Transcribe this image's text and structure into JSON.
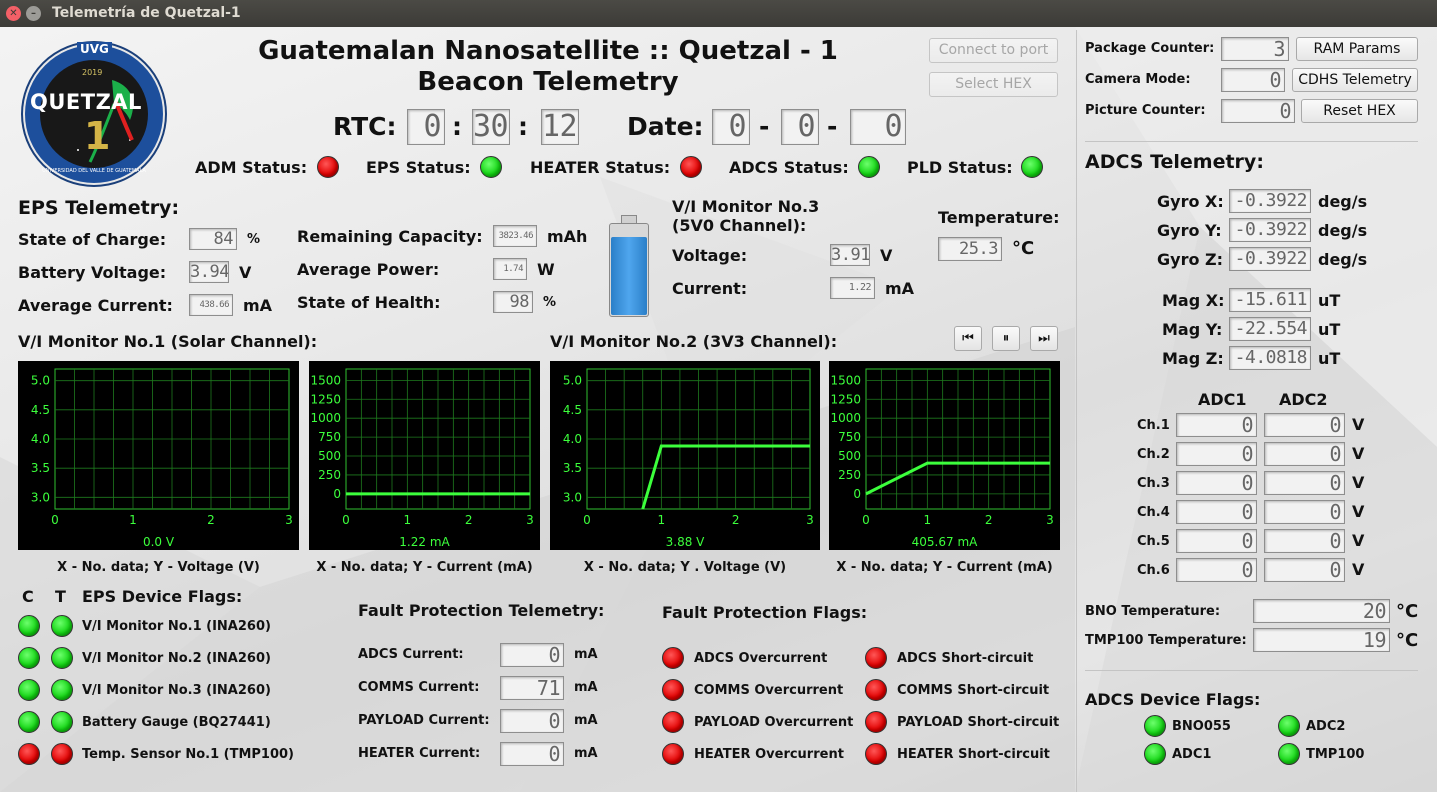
{
  "window": {
    "title": "Telemetría de Quetzal-1"
  },
  "header": {
    "title": "Guatemalan Nanosatellite :: Quetzal - 1",
    "subtitle": "Beacon Telemetry"
  },
  "logo": {
    "top": "UVG",
    "year": "2019",
    "name": "QUETZAL",
    "number": "1",
    "ring": "UNIVERSIDAD DEL VALLE DE GUATEMALA"
  },
  "rtc": {
    "label": "RTC:",
    "h": "0",
    "m": "30",
    "s": "12"
  },
  "date": {
    "label": "Date:",
    "d": "0",
    "mo": "0",
    "y": "0"
  },
  "colon": ":",
  "dash": "-",
  "status": [
    {
      "label": "ADM Status:",
      "color": "red"
    },
    {
      "label": "EPS Status:",
      "color": "green"
    },
    {
      "label": "HEATER Status:",
      "color": "red"
    },
    {
      "label": "ADCS Status:",
      "color": "green"
    },
    {
      "label": "PLD Status:",
      "color": "green"
    }
  ],
  "buttons": {
    "connect": "Connect to port",
    "select_hex": "Select HEX",
    "ram": "RAM Params",
    "cdhs": "CDHS Telemetry",
    "reset": "Reset HEX"
  },
  "counters": {
    "package_label": "Package Counter:",
    "package": "3",
    "camera_label": "Camera Mode:",
    "camera": "0",
    "picture_label": "Picture Counter:",
    "picture": "0"
  },
  "eps": {
    "title": "EPS Telemetry:",
    "soc_label": "State of Charge:",
    "soc": "84",
    "soc_unit": "%",
    "bv_label": "Battery Voltage:",
    "bv": "3.94",
    "bv_unit": "V",
    "ac_label": "Average Current:",
    "ac": "438.66",
    "ac_unit": "mA",
    "rc_label": "Remaining Capacity:",
    "rc": "3823.46",
    "rc_unit": "mAh",
    "ap_label": "Average Power:",
    "ap": "1.74",
    "ap_unit": "W",
    "soh_label": "State of Health:",
    "soh": "98",
    "soh_unit": "%"
  },
  "vi3": {
    "title1": "V/I Monitor No.3",
    "title2": "(5V0 Channel):",
    "v_label": "Voltage:",
    "v": "3.91",
    "v_unit": "V",
    "c_label": "Current:",
    "c": "1.22",
    "c_unit": "mA"
  },
  "temperature": {
    "label": "Temperature:",
    "value": "25.3",
    "unit": "°C"
  },
  "vi1_title": "V/I Monitor No.1 (Solar Channel):",
  "vi2_title": "V/I Monitor No.2 (3V3 Channel):",
  "media": {
    "prev": "⏮",
    "pause": "⏸",
    "next": "⏭"
  },
  "chart_data": [
    {
      "type": "line",
      "x": [],
      "y": [],
      "ylim": [
        2.8,
        5.2
      ],
      "xlim": [
        0,
        3
      ],
      "yticks": [
        "5.0",
        "4.5",
        "4.0",
        "3.5",
        "3.0"
      ],
      "xticks": [
        "0",
        "1",
        "2",
        "3"
      ],
      "readout": "0.0 V",
      "xlabel": "X - No. data; Y - Voltage (V)",
      "color": "#3cff3c"
    },
    {
      "type": "line",
      "x": [
        0,
        3
      ],
      "y": [
        0,
        0
      ],
      "ylim": [
        -200,
        1650
      ],
      "xlim": [
        0,
        3
      ],
      "yticks": [
        "1500",
        "1250",
        "1000",
        "750",
        "500",
        "250",
        "0"
      ],
      "xticks": [
        "0",
        "1",
        "2",
        "3"
      ],
      "readout": "1.22 mA",
      "xlabel": "X - No. data; Y - Current (mA)",
      "color": "#3cff3c"
    },
    {
      "type": "line",
      "x": [
        0.75,
        1,
        3
      ],
      "y": [
        2.8,
        3.88,
        3.88
      ],
      "ylim": [
        2.8,
        5.2
      ],
      "xlim": [
        0,
        3
      ],
      "yticks": [
        "5.0",
        "4.5",
        "4.0",
        "3.5",
        "3.0"
      ],
      "xticks": [
        "0",
        "1",
        "2",
        "3"
      ],
      "readout": "3.88 V",
      "xlabel": "X - No. data; Y . Voltage (V)",
      "color": "#3cff3c"
    },
    {
      "type": "line",
      "x": [
        0,
        1,
        3
      ],
      "y": [
        0,
        405.67,
        405.67
      ],
      "ylim": [
        -200,
        1650
      ],
      "xlim": [
        0,
        3
      ],
      "yticks": [
        "1500",
        "1250",
        "1000",
        "750",
        "500",
        "250",
        "0"
      ],
      "xticks": [
        "0",
        "1",
        "2",
        "3"
      ],
      "readout": "405.67 mA",
      "xlabel": "X - No. data; Y - Current (mA)",
      "color": "#3cff3c"
    }
  ],
  "flags": {
    "c": "C",
    "t": "T",
    "title": "EPS Device Flags:",
    "items": [
      {
        "label": "V/I Monitor No.1 (INA260)",
        "c": "green",
        "t": "green"
      },
      {
        "label": "V/I Monitor No.2 (INA260)",
        "c": "green",
        "t": "green"
      },
      {
        "label": "V/I Monitor No.3 (INA260)",
        "c": "green",
        "t": "green"
      },
      {
        "label": "Battery Gauge (BQ27441)",
        "c": "green",
        "t": "green"
      },
      {
        "label": "Temp. Sensor No.1 (TMP100)",
        "c": "red",
        "t": "red"
      }
    ]
  },
  "fault": {
    "title": "Fault Protection Telemetry:",
    "items": [
      {
        "label": "ADCS Current:",
        "value": "0",
        "unit": "mA"
      },
      {
        "label": "COMMS Current:",
        "value": "71",
        "unit": "mA"
      },
      {
        "label": "PAYLOAD Current:",
        "value": "0",
        "unit": "mA"
      },
      {
        "label": "HEATER Current:",
        "value": "0",
        "unit": "mA"
      }
    ]
  },
  "fault_flags": {
    "title": "Fault Protection Flags:",
    "left": [
      "ADCS Overcurrent",
      "COMMS Overcurrent",
      "PAYLOAD Overcurrent",
      "HEATER Overcurrent"
    ],
    "right": [
      "ADCS Short-circuit",
      "COMMS Short-circuit",
      "PAYLOAD Short-circuit",
      "HEATER Short-circuit"
    ]
  },
  "adcs": {
    "title": "ADCS Telemetry:",
    "gyro": [
      {
        "label": "Gyro X:",
        "value": "-0.3922",
        "unit": "deg/s"
      },
      {
        "label": "Gyro Y:",
        "value": "-0.3922",
        "unit": "deg/s"
      },
      {
        "label": "Gyro Z:",
        "value": "-0.3922",
        "unit": "deg/s"
      }
    ],
    "mag": [
      {
        "label": "Mag X:",
        "value": "-15.611",
        "unit": "uT"
      },
      {
        "label": "Mag Y:",
        "value": "-22.554",
        "unit": "uT"
      },
      {
        "label": "Mag Z:",
        "value": "-4.0818",
        "unit": "uT"
      }
    ],
    "adc1": "ADC1",
    "adc2": "ADC2",
    "channels": [
      {
        "label": "Ch.1",
        "a": "0",
        "b": "0",
        "unit": "V"
      },
      {
        "label": "Ch.2",
        "a": "0",
        "b": "0",
        "unit": "V"
      },
      {
        "label": "Ch.3",
        "a": "0",
        "b": "0",
        "unit": "V"
      },
      {
        "label": "Ch.4",
        "a": "0",
        "b": "0",
        "unit": "V"
      },
      {
        "label": "Ch.5",
        "a": "0",
        "b": "0",
        "unit": "V"
      },
      {
        "label": "Ch.6",
        "a": "0",
        "b": "0",
        "unit": "V"
      }
    ],
    "bno_label": "BNO Temperature:",
    "bno": "20",
    "bno_unit": "°C",
    "tmp_label": "TMP100 Temperature:",
    "tmp": "19",
    "tmp_unit": "°C",
    "flags_title": "ADCS Device Flags:",
    "flags": [
      {
        "label": "BNO055",
        "color": "green"
      },
      {
        "label": "ADC2",
        "color": "green"
      },
      {
        "label": "ADC1",
        "color": "green"
      },
      {
        "label": "TMP100",
        "color": "green"
      }
    ]
  }
}
